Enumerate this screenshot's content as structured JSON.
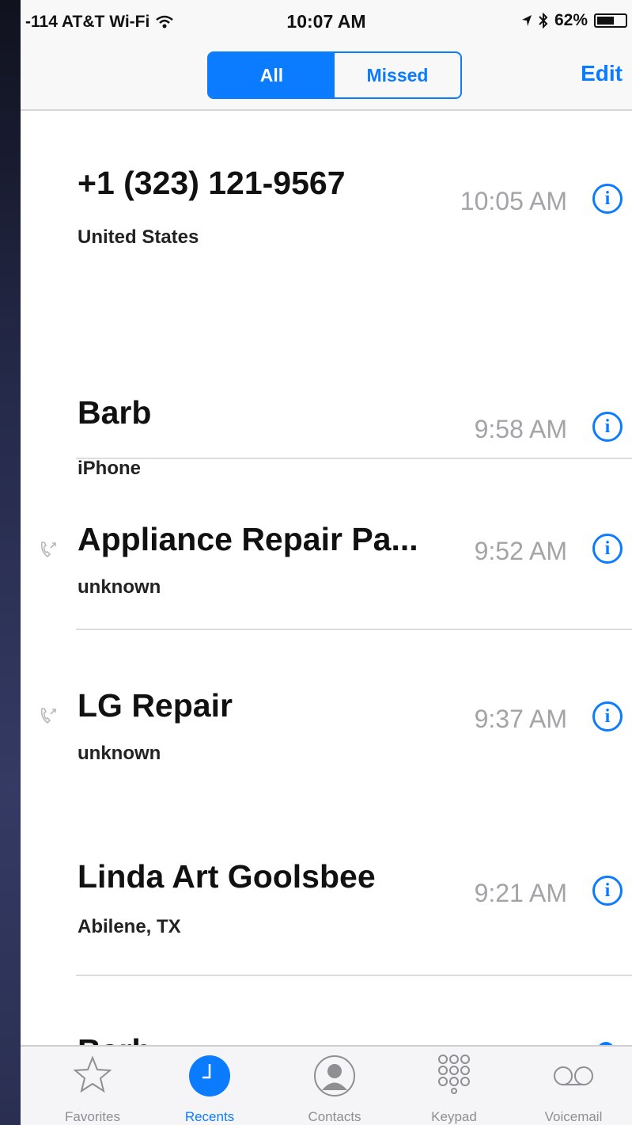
{
  "status_bar": {
    "carrier": "-114 AT&T Wi-Fi",
    "time": "10:07 AM",
    "battery": "62%",
    "battery_level": 0.62
  },
  "nav": {
    "segments": [
      {
        "label": "All",
        "selected": true
      },
      {
        "label": "Missed",
        "selected": false
      }
    ],
    "edit_label": "Edit"
  },
  "calls": [
    {
      "name": "+1 (323) 121-9567",
      "detail": "United States",
      "time": "10:05 AM",
      "outgoing": false
    },
    {
      "name": "Barb",
      "detail": "iPhone",
      "time": "9:58 AM",
      "outgoing": false
    },
    {
      "name": "Appliance Repair Pa...",
      "detail": "unknown",
      "time": "9:52 AM",
      "outgoing": true
    },
    {
      "name": "LG Repair",
      "detail": "unknown",
      "time": "9:37 AM",
      "outgoing": true
    },
    {
      "name": "Linda Art Goolsbee",
      "detail": "Abilene, TX",
      "time": "9:21 AM",
      "outgoing": false
    },
    {
      "name": "Barb",
      "detail": "",
      "time": "",
      "outgoing": false
    }
  ],
  "tabs": [
    {
      "label": "Favorites",
      "icon": "star-icon",
      "active": false
    },
    {
      "label": "Recents",
      "icon": "clock-icon",
      "active": true
    },
    {
      "label": "Contacts",
      "icon": "person-icon",
      "active": false
    },
    {
      "label": "Keypad",
      "icon": "keypad-icon",
      "active": false
    },
    {
      "label": "Voicemail",
      "icon": "voicemail-icon",
      "active": false
    }
  ],
  "colors": {
    "accent": "#0b7cff",
    "time_gray": "#a3a3a8"
  }
}
